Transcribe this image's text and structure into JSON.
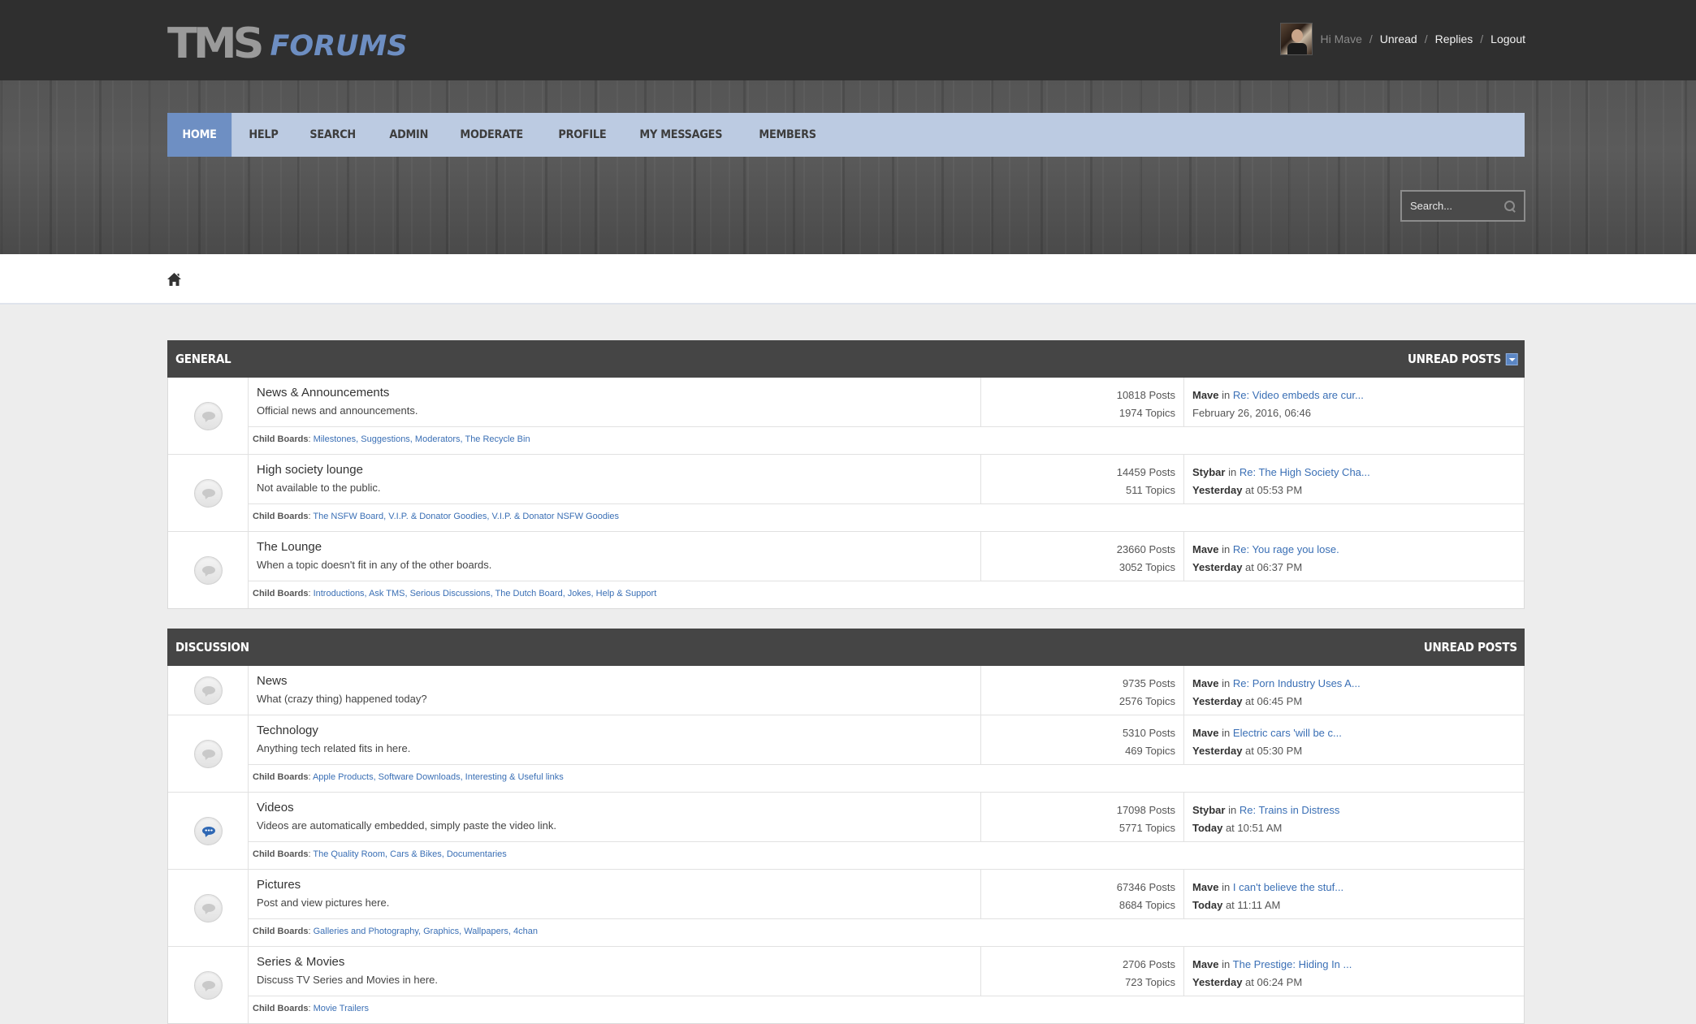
{
  "header": {
    "logo_primary": "TMS",
    "logo_secondary": "FORUMS",
    "greeting": "Hi Mave",
    "links": [
      "Unread",
      "Replies",
      "Logout"
    ]
  },
  "nav": {
    "items": [
      "HOME",
      "HELP",
      "SEARCH",
      "ADMIN",
      "MODERATE",
      "PROFILE",
      "MY MESSAGES",
      "MEMBERS"
    ],
    "active": "HOME"
  },
  "search": {
    "placeholder": "Search..."
  },
  "child_label": "Child Boards",
  "categories": [
    {
      "title": "GENERAL",
      "unread_label": "UNREAD POSTS",
      "boards": [
        {
          "name": "News & Announcements",
          "desc": "Official news and announcements.",
          "posts": "10818 Posts",
          "topics": "1974 Topics",
          "last_user": "Mave",
          "last_topic": "Re: Video embeds are cur...",
          "last_date_bold": "",
          "last_date": "February 26, 2016, 06:46",
          "children": "Milestones, Suggestions, Moderators, The Recycle Bin",
          "new": false
        },
        {
          "name": "High society lounge",
          "desc": "Not available to the public.",
          "posts": "14459 Posts",
          "topics": "511 Topics",
          "last_user": "Stybar",
          "last_topic": "Re: The High Society Cha...",
          "last_date_bold": "Yesterday",
          "last_date": " at 05:53 PM",
          "children": "The NSFW Board, V.I.P. & Donator Goodies, V.I.P. & Donator NSFW Goodies",
          "new": false
        },
        {
          "name": "The Lounge",
          "desc": "When a topic doesn't fit in any of the other boards.",
          "posts": "23660 Posts",
          "topics": "3052 Topics",
          "last_user": "Mave",
          "last_topic": "Re: You rage you lose.",
          "last_date_bold": "Yesterday",
          "last_date": " at 06:37 PM",
          "children": "Introductions, Ask TMS, Serious Discussions, The Dutch Board, Jokes, Help & Support",
          "new": false
        }
      ]
    },
    {
      "title": "DISCUSSION",
      "unread_label": "UNREAD POSTS",
      "boards": [
        {
          "name": "News",
          "desc": "What (crazy thing) happened today?",
          "posts": "9735 Posts",
          "topics": "2576 Topics",
          "last_user": "Mave",
          "last_topic": "Re: Porn Industry Uses A...",
          "last_date_bold": "Yesterday",
          "last_date": " at 06:45 PM",
          "children": "",
          "new": false
        },
        {
          "name": "Technology",
          "desc": "Anything tech related fits in here.",
          "posts": "5310 Posts",
          "topics": "469 Topics",
          "last_user": "Mave",
          "last_topic": "Electric cars 'will be c...",
          "last_date_bold": "Yesterday",
          "last_date": " at 05:30 PM",
          "children": "Apple Products, Software Downloads, Interesting & Useful links",
          "new": false
        },
        {
          "name": "Videos",
          "desc": "Videos are automatically embedded, simply paste the video link.",
          "posts": "17098 Posts",
          "topics": "5771 Topics",
          "last_user": "Stybar",
          "last_topic": "Re: Trains in Distress",
          "last_date_bold": "Today",
          "last_date": " at 10:51 AM",
          "children": "The Quality Room, Cars & Bikes, Documentaries",
          "new": true
        },
        {
          "name": "Pictures",
          "desc": "Post and view pictures here.",
          "posts": "67346 Posts",
          "topics": "8684 Topics",
          "last_user": "Mave",
          "last_topic": "I can't believe the stuf...",
          "last_date_bold": "Today",
          "last_date": " at 11:11 AM",
          "children": "Galleries and Photography, Graphics, Wallpapers, 4chan",
          "new": false
        },
        {
          "name": "Series & Movies",
          "desc": "Discuss TV Series and Movies in here.",
          "posts": "2706 Posts",
          "topics": "723 Topics",
          "last_user": "Mave",
          "last_topic": "The Prestige: Hiding In ...",
          "last_date_bold": "Yesterday",
          "last_date": " at 06:24 PM",
          "children": "Movie Trailers",
          "new": false
        }
      ]
    }
  ],
  "in_word": "in",
  "colors": {
    "accent": "#6e8fc3",
    "nav_bg": "#bccbe2",
    "header_bg": "#2f2f2f",
    "link": "#3a6fb5"
  }
}
